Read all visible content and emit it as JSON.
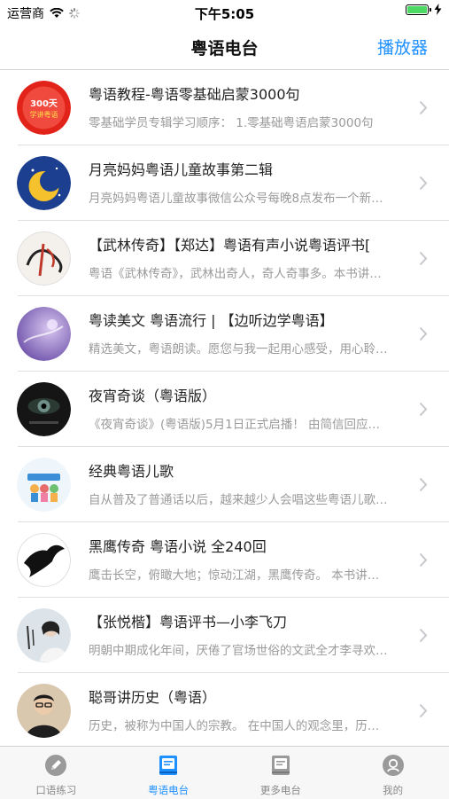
{
  "status_bar": {
    "carrier": "运营商",
    "time": "下午5:05",
    "battery_level": 1.0
  },
  "nav": {
    "title": "粤语电台",
    "right_button": "播放器"
  },
  "list": [
    {
      "title": "粤语教程-粤语零基础启蒙3000句",
      "desc": "零基础学员专辑学习顺序： 1.零基础粤语启蒙3000句",
      "thumb_text": "300天学讲粤语"
    },
    {
      "title": "月亮妈妈粤语儿童故事第二辑",
      "desc": "月亮妈妈粤语儿童故事微信公众号每晚8点发布一个新故事…"
    },
    {
      "title": "【武林传奇】【郑达】粤语有声小说粤语评书[",
      "desc": "粤语《武林传奇》，武林出奇人，奇人奇事多。本书讲述…"
    },
    {
      "title": "粤读美文 粤语流行 | 【边听边学粤语】",
      "desc": "精选美文，粤语朗读。愿您与我一起用心感受，用心聆听…"
    },
    {
      "title": "夜宵奇谈（粤语版）",
      "desc": "《夜宵奇谈》(粤语版)5月1日正式启播！ 由简信回应…"
    },
    {
      "title": "经典粤语儿歌",
      "desc": "自从普及了普通话以后，越来越少人会唱这些粤语儿歌…"
    },
    {
      "title": "黑鹰传奇 粤语小说 全240回",
      "desc": "鹰击长空，俯瞰大地；惊动江湖，黑鹰传奇。 本书讲述…"
    },
    {
      "title": "【张悦楷】粤语评书—小李飞刀",
      "desc": "明朝中期成化年间，厌倦了官场世俗的文武全才李寻欢…"
    },
    {
      "title": "聪哥讲历史（粤语）",
      "desc": "历史，被称为中国人的宗教。 在中国人的观念里，历史…"
    }
  ],
  "tabs": [
    {
      "label": "口语练习",
      "icon": "pencil-icon",
      "active": false
    },
    {
      "label": "粤语电台",
      "icon": "radio-book-icon",
      "active": true
    },
    {
      "label": "更多电台",
      "icon": "book-icon",
      "active": false
    },
    {
      "label": "我的",
      "icon": "user-icon",
      "active": false
    }
  ],
  "colors": {
    "accent": "#1e90ff",
    "tab_inactive": "#8a8a8a",
    "battery": "#4cd964"
  }
}
